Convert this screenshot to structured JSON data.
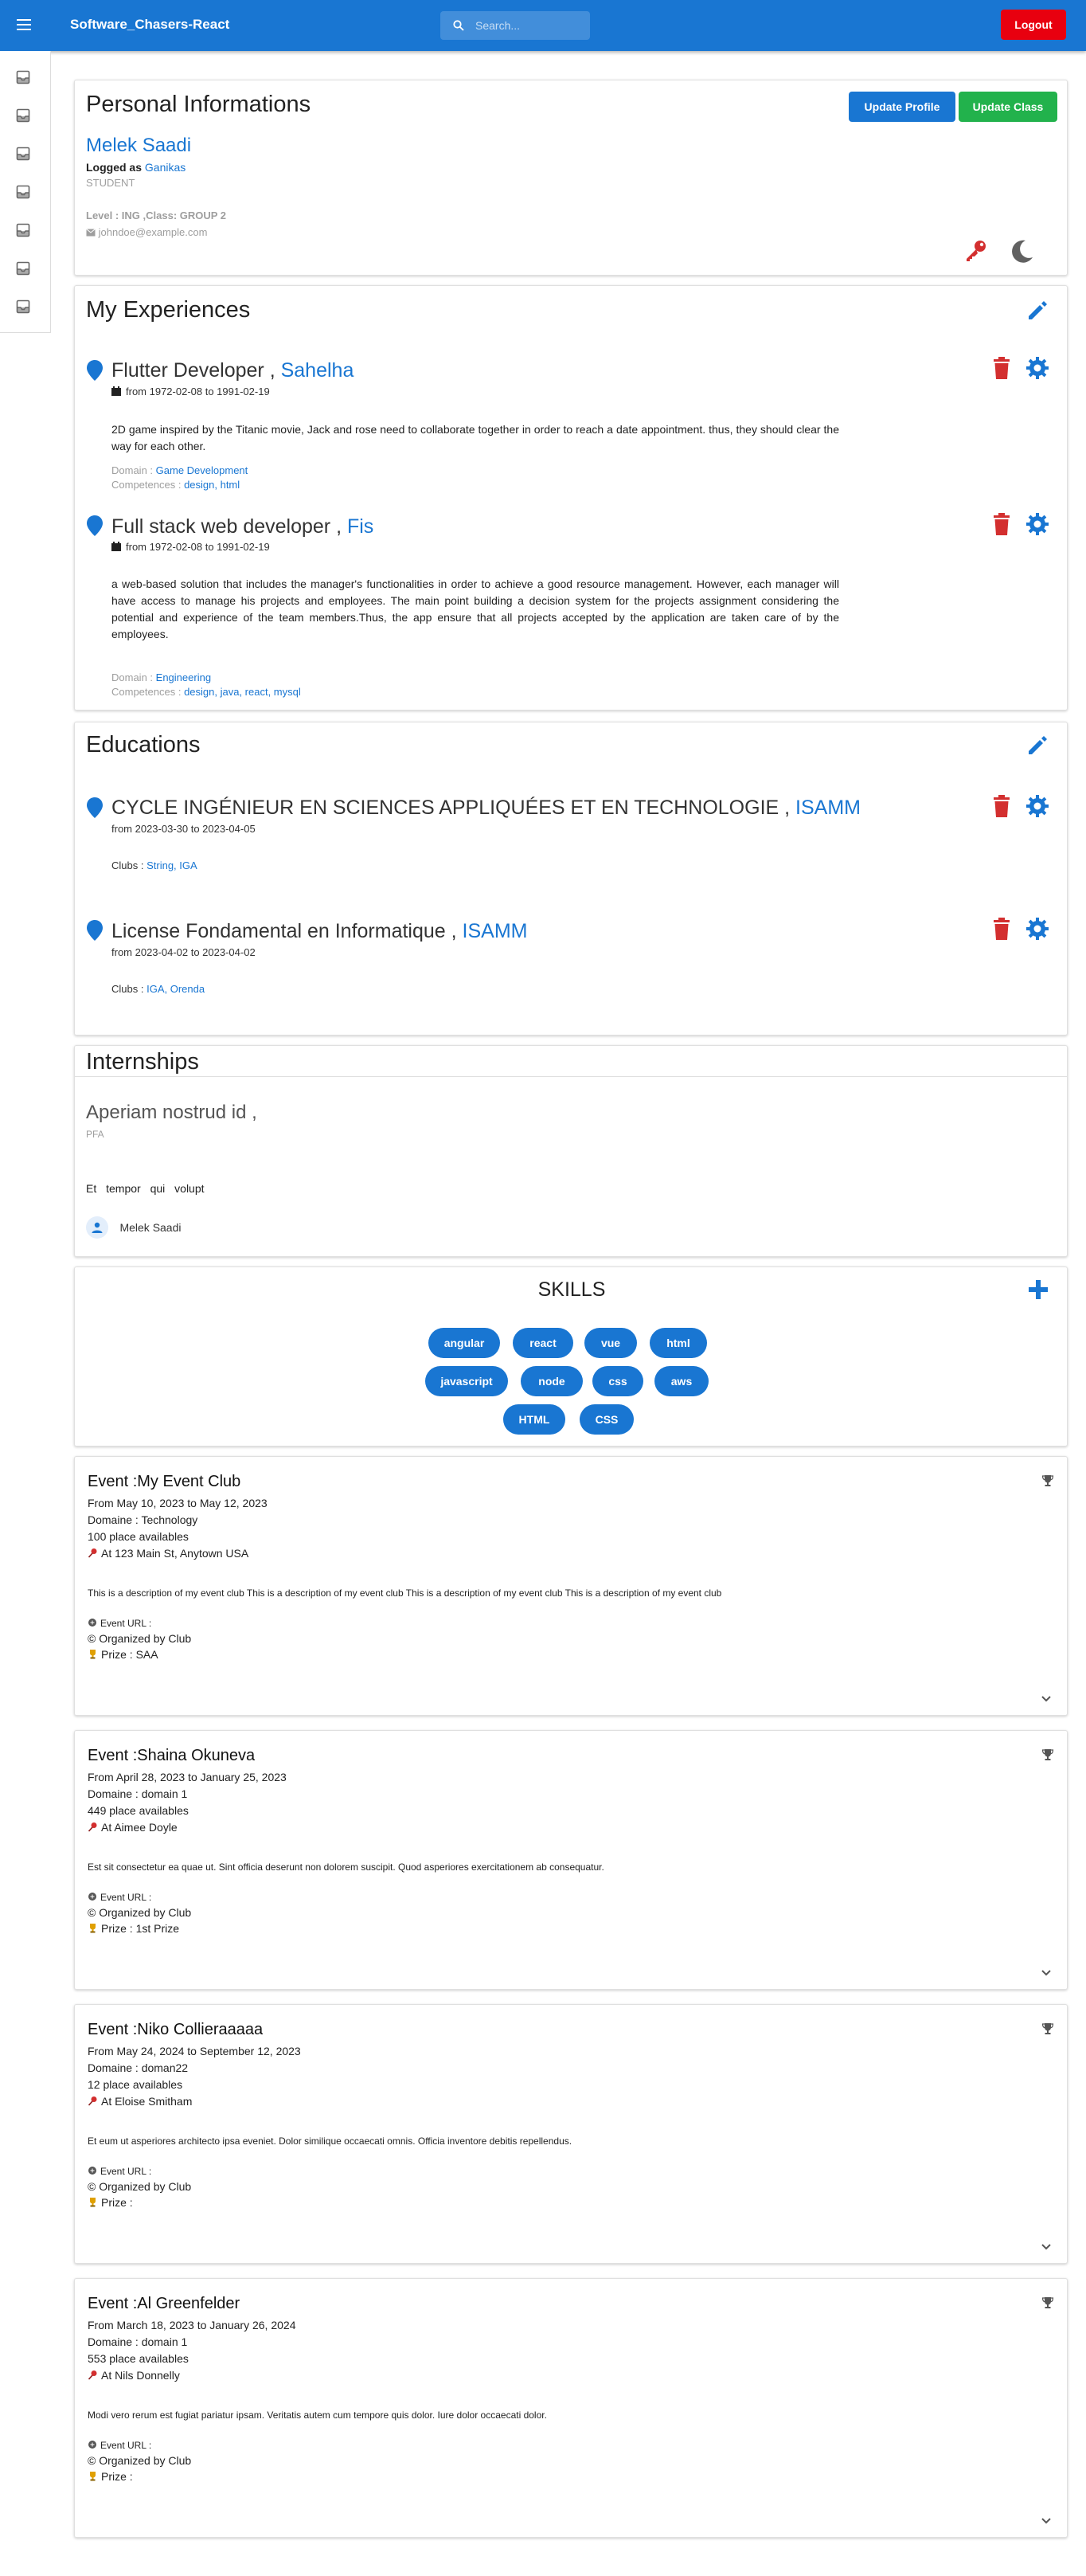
{
  "app": {
    "title": "Software_Chasers-React",
    "search_placeholder": "Search...",
    "logout_label": "Logout"
  },
  "sidebar": {
    "items": [
      "inbox-icon",
      "inbox-icon",
      "inbox-icon",
      "inbox-icon",
      "inbox-icon",
      "inbox-icon",
      "inbox-icon"
    ]
  },
  "profile": {
    "heading": "Personal Informations",
    "update_profile_label": "Update Profile",
    "update_class_label": "Update Class",
    "name": "Melek Saadi",
    "logged_as_label": "Logged as",
    "logged_as_value": "Ganikas",
    "role": "STUDENT",
    "level": "Level : ING ,Class: GROUP 2",
    "email": "johndoe@example.com",
    "colors": {
      "key": "#d32f2f",
      "moon": "#616161"
    }
  },
  "experiences": {
    "heading": "My Experiences",
    "items": [
      {
        "title": "Flutter Developer ,",
        "company": "Sahelha",
        "dates": "from 1972-02-08 to 1991-02-19",
        "description": "2D game inspired by the Titanic movie, Jack and rose need to collaborate together in order to reach a date appointment. thus, they should clear the way for each other.",
        "domain_label": "Domain :",
        "domain": "Game Development",
        "competences_label": "Competences :",
        "competences": "design, html"
      },
      {
        "title": "Full stack web developer ,",
        "company": "Fis",
        "dates": "from 1972-02-08 to 1991-02-19",
        "description": "a web-based solution that includes the manager's functionalities in order to achieve a good resource management. However, each manager will have access to manage his projects and employees. The main point building a decision system for the projects assignment considering the potential and experience of the team members.Thus, the app ensure that all projects accepted by the application are taken care of by the employees.",
        "domain_label": "Domain :",
        "domain": "Engineering",
        "competences_label": "Competences :",
        "competences": "design, java, react, mysql"
      }
    ]
  },
  "educations": {
    "heading": "Educations",
    "items": [
      {
        "title": "CYCLE INGÉNIEUR EN SCIENCES APPLIQUÉES ET EN TECHNOLOGIE ,",
        "school": "ISAMM",
        "dates": "from 2023-03-30 to 2023-04-05",
        "clubs_label": "Clubs :",
        "clubs": "String, IGA"
      },
      {
        "title": "License Fondamental en Informatique ,",
        "school": "ISAMM",
        "dates": "from 2023-04-02 to 2023-04-02",
        "clubs_label": "Clubs :",
        "clubs": "IGA, Orenda"
      }
    ]
  },
  "internships": {
    "heading": "Internships",
    "title": "Aperiam nostrud id ,",
    "type": "PFA",
    "description": "Et tempor qui volupt",
    "supervisor": "Melek Saadi"
  },
  "skills": {
    "heading": "SKILLS",
    "rows": [
      [
        "angular",
        "react",
        "vue",
        "html"
      ],
      [
        "javascript",
        "node",
        "css",
        "aws"
      ],
      [
        "HTML",
        "CSS"
      ]
    ]
  },
  "events": [
    {
      "title": "Event :My Event Club",
      "dates": "From May 10, 2023 to May 12, 2023",
      "domain": "Domaine : Technology",
      "places": "100 place availables",
      "location": "At 123 Main St, Anytown USA",
      "description": "This is a description of my event club This is a description of my event club This is a description of my event club This is a description of my event club",
      "url_label": "Event URL :",
      "organizer": "© Organized by Club",
      "prize": "Prize : SAA"
    },
    {
      "title": "Event :Shaina Okuneva",
      "dates": "From April 28, 2023 to January 25, 2023",
      "domain": "Domaine : domain 1",
      "places": "449 place availables",
      "location": "At Aimee Doyle",
      "description": "Est sit consectetur ea quae ut. Sint officia deserunt non dolorem suscipit. Quod asperiores exercitationem ab consequatur.",
      "url_label": "Event URL :",
      "organizer": "© Organized by Club",
      "prize": "Prize : 1st Prize"
    },
    {
      "title": "Event :Niko Collieraaaaa",
      "dates": "From May 24, 2024 to September 12, 2023",
      "domain": "Domaine : doman22",
      "places": "12 place availables",
      "location": "At Eloise Smitham",
      "description": "Et eum ut asperiores architecto ipsa eveniet. Dolor similique occaecati omnis. Officia inventore debitis repellendus.",
      "url_label": "Event URL :",
      "organizer": "© Organized by Club",
      "prize": "Prize :"
    },
    {
      "title": "Event :Al Greenfelder",
      "dates": "From March 18, 2023 to January 26, 2024",
      "domain": "Domaine : domain 1",
      "places": "553 place availables",
      "location": "At Nils Donnelly",
      "description": "Modi vero rerum est fugiat pariatur ipsam. Veritatis autem cum tempore quis dolor. Iure dolor occaecati dolor.",
      "url_label": "Event URL :",
      "organizer": "© Organized by Club",
      "prize": "Prize :"
    }
  ],
  "colors": {
    "primary": "#1976d2",
    "danger": "#d32f2f",
    "success": "#22b24c",
    "logout": "#e8000f"
  }
}
